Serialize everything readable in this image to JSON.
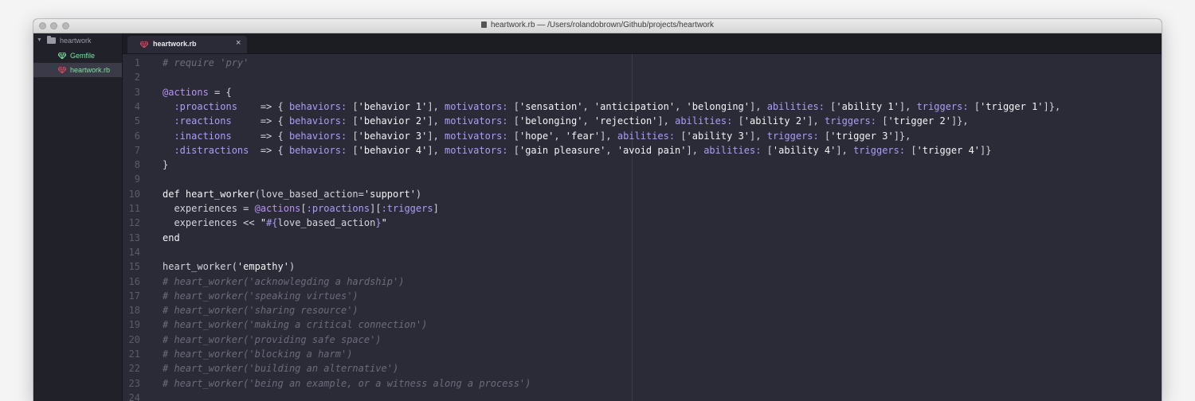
{
  "window": {
    "title": "heartwork.rb — /Users/rolandobrown/Github/projects/heartwork"
  },
  "sidebar": {
    "folder": "heartwork",
    "files": [
      {
        "name": "Gemfile"
      },
      {
        "name": "heartwork.rb",
        "selected": true
      }
    ]
  },
  "tabs": [
    {
      "label": "heartwork.rb",
      "close": "×"
    }
  ],
  "colors": {
    "accent": "#7ee29e",
    "ruby_red": "#e0485e",
    "background": "#2b2b37"
  },
  "icons": [
    "folder-icon",
    "ruby-gem-icon",
    "close-icon",
    "disclosure-arrow-icon"
  ],
  "editor": {
    "lines": [
      {
        "n": "1",
        "tokens": [
          {
            "c": "c",
            "t": "# require 'pry'"
          }
        ]
      },
      {
        "n": "2",
        "tokens": []
      },
      {
        "n": "3",
        "tokens": [
          {
            "c": "iv",
            "t": "@actions"
          },
          {
            "c": "p",
            "t": " = {"
          }
        ]
      },
      {
        "n": "4",
        "tokens": [
          {
            "c": "sym",
            "t": "  :proactions"
          },
          {
            "c": "p",
            "t": "    => { "
          },
          {
            "c": "key",
            "t": "behaviors:"
          },
          {
            "c": "p",
            "t": " ["
          },
          {
            "c": "str",
            "t": "'behavior 1'"
          },
          {
            "c": "p",
            "t": "], "
          },
          {
            "c": "key",
            "t": "motivators:"
          },
          {
            "c": "p",
            "t": " ["
          },
          {
            "c": "str",
            "t": "'sensation'"
          },
          {
            "c": "p",
            "t": ", "
          },
          {
            "c": "str",
            "t": "'anticipation'"
          },
          {
            "c": "p",
            "t": ", "
          },
          {
            "c": "str",
            "t": "'belonging'"
          },
          {
            "c": "p",
            "t": "], "
          },
          {
            "c": "key",
            "t": "abilities:"
          },
          {
            "c": "p",
            "t": " ["
          },
          {
            "c": "str",
            "t": "'ability 1'"
          },
          {
            "c": "p",
            "t": "], "
          },
          {
            "c": "key",
            "t": "triggers:"
          },
          {
            "c": "p",
            "t": " ["
          },
          {
            "c": "str",
            "t": "'trigger 1'"
          },
          {
            "c": "p",
            "t": "]},"
          }
        ]
      },
      {
        "n": "5",
        "tokens": [
          {
            "c": "sym",
            "t": "  :reactions"
          },
          {
            "c": "p",
            "t": "     => { "
          },
          {
            "c": "key",
            "t": "behaviors:"
          },
          {
            "c": "p",
            "t": " ["
          },
          {
            "c": "str",
            "t": "'behavior 2'"
          },
          {
            "c": "p",
            "t": "], "
          },
          {
            "c": "key",
            "t": "motivators:"
          },
          {
            "c": "p",
            "t": " ["
          },
          {
            "c": "str",
            "t": "'belonging'"
          },
          {
            "c": "p",
            "t": ", "
          },
          {
            "c": "str",
            "t": "'rejection'"
          },
          {
            "c": "p",
            "t": "], "
          },
          {
            "c": "key",
            "t": "abilities:"
          },
          {
            "c": "p",
            "t": " ["
          },
          {
            "c": "str",
            "t": "'ability 2'"
          },
          {
            "c": "p",
            "t": "], "
          },
          {
            "c": "key",
            "t": "triggers:"
          },
          {
            "c": "p",
            "t": " ["
          },
          {
            "c": "str",
            "t": "'trigger 2'"
          },
          {
            "c": "p",
            "t": "]},"
          }
        ]
      },
      {
        "n": "6",
        "tokens": [
          {
            "c": "sym",
            "t": "  :inactions"
          },
          {
            "c": "p",
            "t": "     => { "
          },
          {
            "c": "key",
            "t": "behaviors:"
          },
          {
            "c": "p",
            "t": " ["
          },
          {
            "c": "str",
            "t": "'behavior 3'"
          },
          {
            "c": "p",
            "t": "], "
          },
          {
            "c": "key",
            "t": "motivators:"
          },
          {
            "c": "p",
            "t": " ["
          },
          {
            "c": "str",
            "t": "'hope'"
          },
          {
            "c": "p",
            "t": ", "
          },
          {
            "c": "str",
            "t": "'fear'"
          },
          {
            "c": "p",
            "t": "], "
          },
          {
            "c": "key",
            "t": "abilities:"
          },
          {
            "c": "p",
            "t": " ["
          },
          {
            "c": "str",
            "t": "'ability 3'"
          },
          {
            "c": "p",
            "t": "], "
          },
          {
            "c": "key",
            "t": "triggers:"
          },
          {
            "c": "p",
            "t": " ["
          },
          {
            "c": "str",
            "t": "'trigger 3'"
          },
          {
            "c": "p",
            "t": "]},"
          }
        ]
      },
      {
        "n": "7",
        "tokens": [
          {
            "c": "sym",
            "t": "  :distractions"
          },
          {
            "c": "p",
            "t": "  => { "
          },
          {
            "c": "key",
            "t": "behaviors:"
          },
          {
            "c": "p",
            "t": " ["
          },
          {
            "c": "str",
            "t": "'behavior 4'"
          },
          {
            "c": "p",
            "t": "], "
          },
          {
            "c": "key",
            "t": "motivators:"
          },
          {
            "c": "p",
            "t": " ["
          },
          {
            "c": "str",
            "t": "'gain pleasure'"
          },
          {
            "c": "p",
            "t": ", "
          },
          {
            "c": "str",
            "t": "'avoid pain'"
          },
          {
            "c": "p",
            "t": "], "
          },
          {
            "c": "key",
            "t": "abilities:"
          },
          {
            "c": "p",
            "t": " ["
          },
          {
            "c": "str",
            "t": "'ability 4'"
          },
          {
            "c": "p",
            "t": "], "
          },
          {
            "c": "key",
            "t": "triggers:"
          },
          {
            "c": "p",
            "t": " ["
          },
          {
            "c": "str",
            "t": "'trigger 4'"
          },
          {
            "c": "p",
            "t": "]}"
          }
        ]
      },
      {
        "n": "8",
        "tokens": [
          {
            "c": "p",
            "t": "}"
          }
        ]
      },
      {
        "n": "9",
        "tokens": []
      },
      {
        "n": "10",
        "tokens": [
          {
            "c": "kw",
            "t": "def "
          },
          {
            "c": "fn",
            "t": "heart_worker"
          },
          {
            "c": "p",
            "t": "(love_based_action="
          },
          {
            "c": "str",
            "t": "'support'"
          },
          {
            "c": "p",
            "t": ")"
          }
        ]
      },
      {
        "n": "11",
        "tokens": [
          {
            "c": "p",
            "t": "  experiences = "
          },
          {
            "c": "iv",
            "t": "@actions"
          },
          {
            "c": "p",
            "t": "["
          },
          {
            "c": "sym",
            "t": ":proactions"
          },
          {
            "c": "p",
            "t": "]["
          },
          {
            "c": "sym",
            "t": ":triggers"
          },
          {
            "c": "p",
            "t": "]"
          }
        ]
      },
      {
        "n": "12",
        "tokens": [
          {
            "c": "p",
            "t": "  experiences << "
          },
          {
            "c": "str",
            "t": "\""
          },
          {
            "c": "interp",
            "t": "#{"
          },
          {
            "c": "p",
            "t": "love_based_action"
          },
          {
            "c": "interp",
            "t": "}"
          },
          {
            "c": "str",
            "t": "\""
          }
        ]
      },
      {
        "n": "13",
        "tokens": [
          {
            "c": "kw",
            "t": "end"
          }
        ]
      },
      {
        "n": "14",
        "tokens": []
      },
      {
        "n": "15",
        "tokens": [
          {
            "c": "p",
            "t": "heart_worker("
          },
          {
            "c": "str",
            "t": "'empathy'"
          },
          {
            "c": "p",
            "t": ")"
          }
        ]
      },
      {
        "n": "16",
        "tokens": [
          {
            "c": "c",
            "t": "# heart_worker('acknowlegding a hardship')"
          }
        ]
      },
      {
        "n": "17",
        "tokens": [
          {
            "c": "c",
            "t": "# heart_worker('speaking virtues')"
          }
        ]
      },
      {
        "n": "18",
        "tokens": [
          {
            "c": "c",
            "t": "# heart_worker('sharing resource')"
          }
        ]
      },
      {
        "n": "19",
        "tokens": [
          {
            "c": "c",
            "t": "# heart_worker('making a critical connection')"
          }
        ]
      },
      {
        "n": "20",
        "tokens": [
          {
            "c": "c",
            "t": "# heart_worker('providing safe space')"
          }
        ]
      },
      {
        "n": "21",
        "tokens": [
          {
            "c": "c",
            "t": "# heart_worker('blocking a harm')"
          }
        ]
      },
      {
        "n": "22",
        "tokens": [
          {
            "c": "c",
            "t": "# heart_worker('building an alternative')"
          }
        ]
      },
      {
        "n": "23",
        "tokens": [
          {
            "c": "c",
            "t": "# heart_worker('being an example, or a witness along a process')"
          }
        ]
      },
      {
        "n": "24",
        "tokens": []
      }
    ]
  }
}
